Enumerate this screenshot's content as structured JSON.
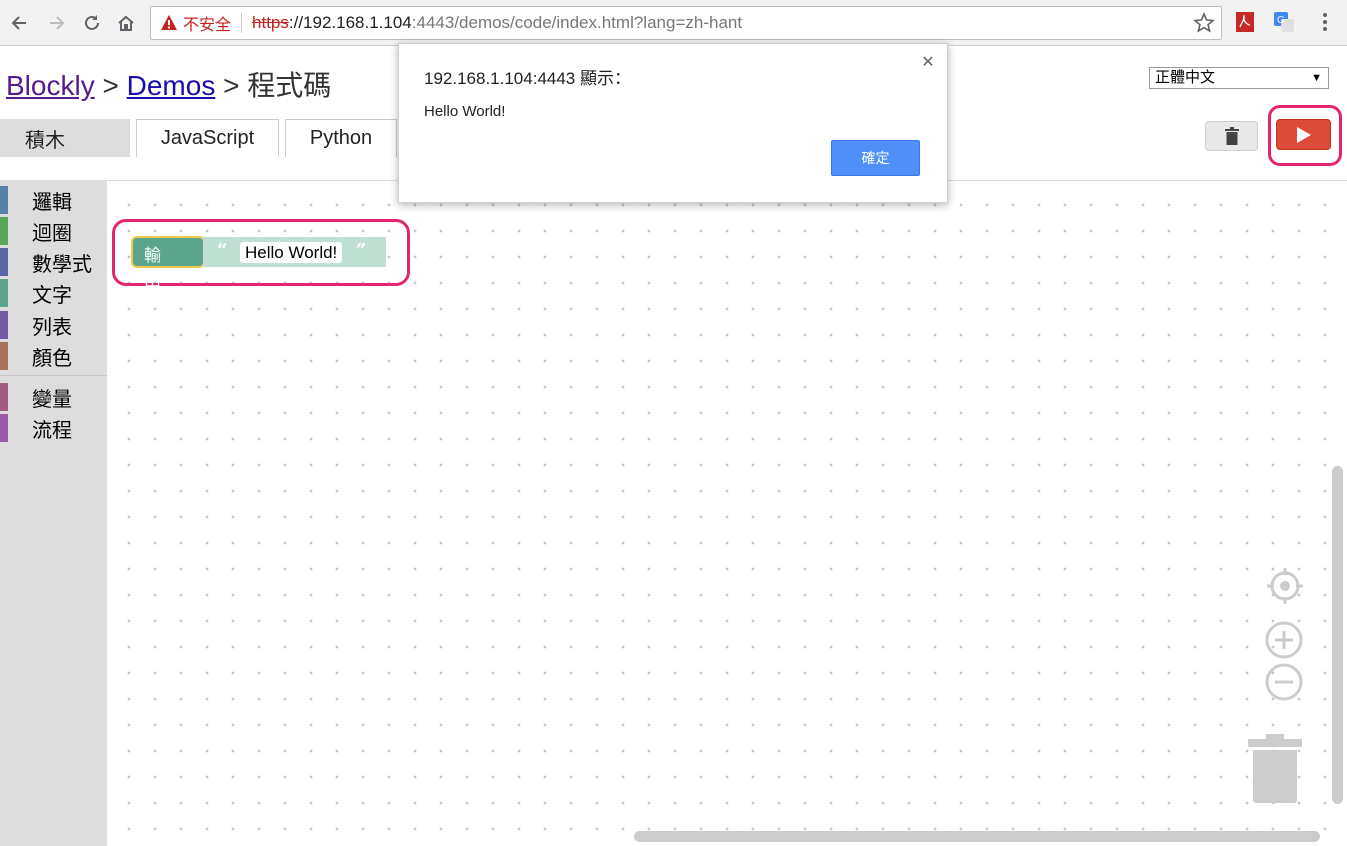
{
  "browser": {
    "security_label": "不安全",
    "url_scheme": "https",
    "url_host": "://192.168.1.104",
    "url_rest": ":4443/demos/code/index.html?lang=zh-hant"
  },
  "breadcrumb": {
    "root": "Blockly",
    "sep1": " > ",
    "demos": "Demos",
    "sep2": " > ",
    "current": "程式碼"
  },
  "language_select": {
    "selected": "正體中文"
  },
  "tabs": [
    {
      "label": "積木"
    },
    {
      "label": "JavaScript"
    },
    {
      "label": "Python"
    }
  ],
  "toolbox": {
    "categories": [
      {
        "label": "邏輯",
        "color": "#5b80a5"
      },
      {
        "label": "迴圈",
        "color": "#5ba55b"
      },
      {
        "label": "數學式",
        "color": "#5b67a5"
      },
      {
        "label": "文字",
        "color": "#5ba58c"
      },
      {
        "label": "列表",
        "color": "#745ba5"
      },
      {
        "label": "顏色",
        "color": "#a5745b"
      },
      {
        "label": "變量",
        "color": "#a55b80"
      },
      {
        "label": "流程",
        "color": "#995ba5"
      }
    ]
  },
  "workspace": {
    "block": {
      "print_label": "輸出",
      "text_value": "Hello World!"
    }
  },
  "dialog": {
    "title": "192.168.1.104:4443 顯示：",
    "message": "Hello World!",
    "ok_label": "確定"
  },
  "colors": {
    "run_button": "#dd4b39",
    "highlight": "#e6256f",
    "dialog_ok": "#4f8ff7"
  }
}
